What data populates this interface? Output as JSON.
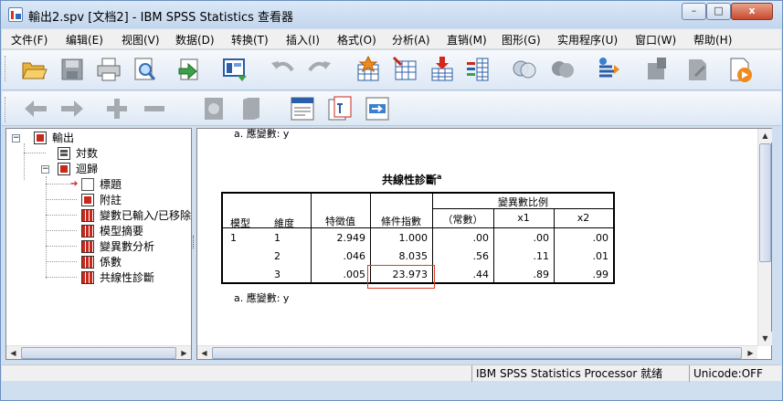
{
  "window": {
    "title": "輸出2.spv [文档2] - IBM SPSS Statistics 查看器",
    "buttons": {
      "minimize": "–",
      "maximize": "□",
      "close": "x"
    }
  },
  "menu": [
    "文件(F)",
    "编辑(E)",
    "视图(V)",
    "数据(D)",
    "转换(T)",
    "插入(I)",
    "格式(O)",
    "分析(A)",
    "直销(M)",
    "图形(G)",
    "实用程序(U)",
    "窗口(W)",
    "帮助(H)"
  ],
  "toolbar1_icons": [
    "open-icon",
    "save-icon",
    "print-icon",
    "print-preview-icon",
    "export-icon",
    "recall-dialog-icon",
    "undo-icon",
    "redo-icon",
    "goto-data-icon",
    "goto-case-icon",
    "goto-variable-icon",
    "variables-icon",
    "use-variable-sets-icon",
    "show-all-variables-icon",
    "select-cases-icon",
    "designate-window-icon",
    "edit-icon",
    "pivot-icon",
    "script-icon"
  ],
  "toolbar2_icons": [
    "back-arrow-icon",
    "forward-arrow-icon",
    "expand-icon",
    "collapse-icon",
    "show-icon",
    "hide-icon",
    "insert-heading-icon",
    "insert-title-icon",
    "insert-text-icon"
  ],
  "tree": {
    "root": "輸出",
    "log": "対数",
    "regression": "迴歸",
    "children": [
      "標題",
      "附註",
      "變數已輸入/已移除",
      "模型摘要",
      "變異數分析",
      "係數",
      "共線性診斷"
    ]
  },
  "output": {
    "top_footnote": "a. 應變數: y",
    "table": {
      "title": "共線性診斷",
      "title_superscript": "a",
      "header_group": "變異數比例",
      "headers": [
        "模型",
        "維度",
        "特徵值",
        "條件指數",
        "（常數）",
        "x1",
        "x2"
      ],
      "rows": [
        [
          "1",
          "1",
          "2.949",
          "1.000",
          ".00",
          ".00",
          ".00"
        ],
        [
          "",
          "2",
          ".046",
          "8.035",
          ".56",
          ".11",
          ".01"
        ],
        [
          "",
          "3",
          ".005",
          "23.973",
          ".44",
          ".89",
          ".99"
        ]
      ]
    },
    "bottom_footnote": "a. 應變數: y"
  },
  "status": {
    "processor": "IBM SPSS Statistics Processor 就绪",
    "unicode": "Unicode:OFF"
  }
}
